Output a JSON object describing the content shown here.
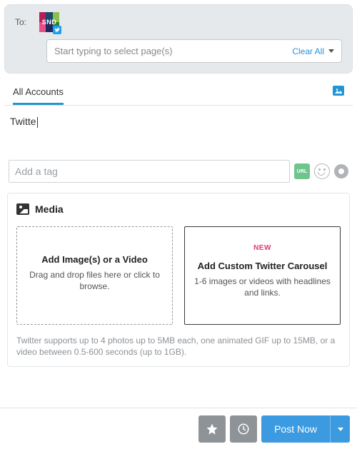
{
  "to": {
    "label": "To:",
    "account_text": "SND",
    "page_select_placeholder": "Start typing to select page(s)",
    "clear_all": "Clear All"
  },
  "tabs": {
    "all_accounts": "All Accounts"
  },
  "compose": {
    "text": "Twitte"
  },
  "tag": {
    "placeholder": "Add a tag"
  },
  "media": {
    "title": "Media",
    "upload": {
      "title": "Add Image(s) or a Video",
      "sub": "Drag and drop files here or click to browse."
    },
    "carousel": {
      "new_label": "NEW",
      "title": "Add Custom Twitter Carousel",
      "sub": "1-6 images or videos with headlines and links."
    },
    "note": "Twitter supports up to 4 photos up to 5MB each, one animated GIF up to 15MB, or a video between 0.5-600 seconds (up to 1GB)."
  },
  "actions": {
    "post_now": "Post Now"
  }
}
